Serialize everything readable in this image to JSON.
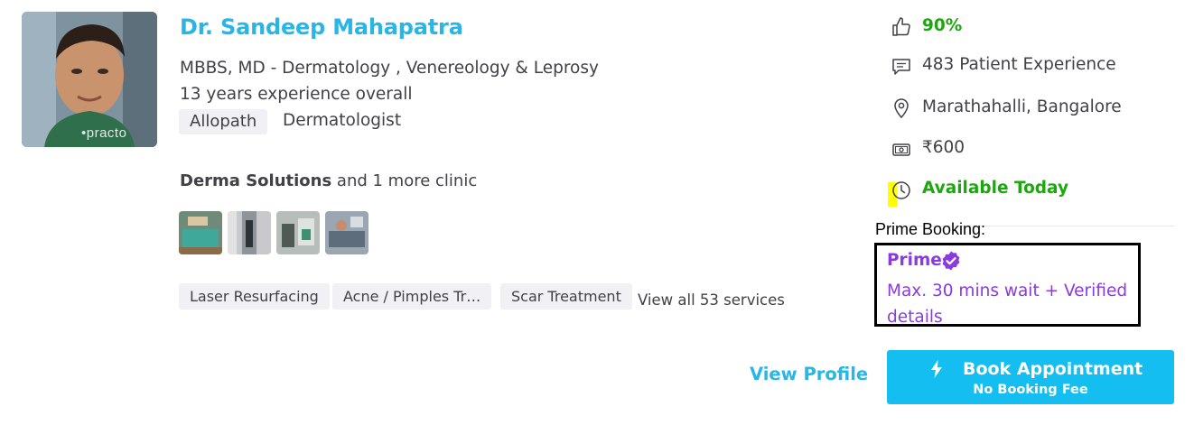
{
  "doctor": {
    "name": "Dr. Sandeep Mahapatra",
    "qualification": "MBBS, MD - Dermatology , Venereology & Leprosy",
    "experience": "13 years experience overall",
    "system": "Allopath",
    "specialty": "Dermatologist",
    "photo_watermark": "•practo"
  },
  "clinic": {
    "name": "Derma Solutions",
    "more": "and 1 more clinic",
    "photos": [
      "clinic-photo",
      "clinic-photo",
      "clinic-photo",
      "clinic-photo"
    ]
  },
  "services": {
    "chips": [
      "Laser Resurfacing",
      "Acne / Pimples Tr…",
      "Scar Treatment"
    ],
    "view_all": "View all 53 services"
  },
  "stats": {
    "recommendation": "90%",
    "patient_experience": "483 Patient Experience",
    "location": "Marathahalli, Bangalore",
    "fee": "₹600",
    "availability": "Available Today"
  },
  "prime": {
    "label": "Prime Booking:",
    "title": "Prime",
    "description": "Max. 30 mins wait + Verified details"
  },
  "actions": {
    "view_profile": "View Profile",
    "book": "Book Appointment",
    "book_sub": "No Booking Fee"
  },
  "colors": {
    "brand_blue": "#28b6e6",
    "button_blue": "#14bef0",
    "green": "#1aa80c",
    "prime_purple": "#8a3ae0"
  },
  "icons": [
    "thumbs-up-icon",
    "chat-icon",
    "location-pin-icon",
    "money-icon",
    "clock-icon",
    "verified-check-icon",
    "bolt-icon"
  ]
}
